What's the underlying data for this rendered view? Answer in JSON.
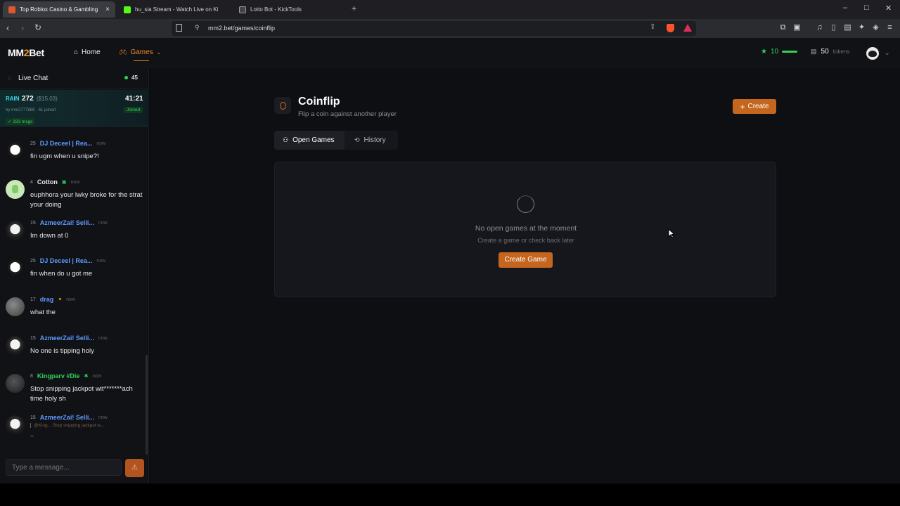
{
  "browser": {
    "tabs": [
      {
        "title": "Top Roblox Casino & Gambling",
        "active": true,
        "close": "×"
      },
      {
        "title": "hu_sia Stream - Watch Live on Ki",
        "active": false
      },
      {
        "title": "Lotto Bot - KickTools",
        "active": false
      }
    ],
    "new_tab": "+",
    "url": "mm2.bet/games/coinflip",
    "window_controls": {
      "minimize": "–",
      "maximize": "□",
      "close": "✕"
    }
  },
  "site": {
    "logo_a": "MM",
    "logo_b": "2",
    "logo_c": "Bet",
    "nav": {
      "home": "Home",
      "games": "Games"
    },
    "level": "10",
    "tokens_value": "50",
    "tokens_label": "tokens"
  },
  "chat": {
    "title": "Live Chat",
    "online": "45",
    "rain": {
      "label": "RAIN",
      "amount": "272",
      "usd": "($15.03)",
      "timer": "41:21",
      "by": "by mm2777888 · 61 joined",
      "joined": "Joined",
      "msgs": "✓ 333 msgs"
    },
    "messages": [
      {
        "level": "25",
        "name": "DJ Deceel | Rea...",
        "time": "now",
        "text": "fin ugm when u snipe?!",
        "color": "#5e9bff"
      },
      {
        "level": "4",
        "name": "Cotton",
        "time": "now",
        "text": "euphhora your lwky broke for the strat your doing",
        "color": "#e8e8e8"
      },
      {
        "level": "15",
        "name": "AzmeerZai! Selli...",
        "time": "now",
        "text": "Im down at 0",
        "color": "#5e9bff"
      },
      {
        "level": "25",
        "name": "DJ Deceel | Rea...",
        "time": "now",
        "text": "fin when do u got me",
        "color": "#5e9bff"
      },
      {
        "level": "17",
        "name": "drag",
        "time": "now",
        "text": "what the",
        "color": "#5e9bff"
      },
      {
        "level": "15",
        "name": "AzmeerZai! Selli...",
        "time": "now",
        "text": "No one is tipping holy",
        "color": "#5e9bff"
      },
      {
        "level": "8",
        "name": "Kingparv #Die",
        "time": "now",
        "text": "Stop snipping jackpot wit*******ach time holy sh",
        "color": "#2ed35a"
      },
      {
        "level": "15",
        "name": "AzmeerZai! Selli...",
        "time": "now",
        "text": "..",
        "color": "#5e9bff",
        "reply": "@King...   Stop snipping jackpot w..."
      }
    ],
    "input_placeholder": "Type a message..."
  },
  "coinflip": {
    "title": "Coinflip",
    "subtitle": "Flip a coin against another player",
    "create_label": "Create",
    "tabs": {
      "open": "Open Games",
      "history": "History"
    },
    "empty_title": "No open games at the moment",
    "empty_sub": "Create a game or check back later",
    "create_game": "Create Game"
  }
}
